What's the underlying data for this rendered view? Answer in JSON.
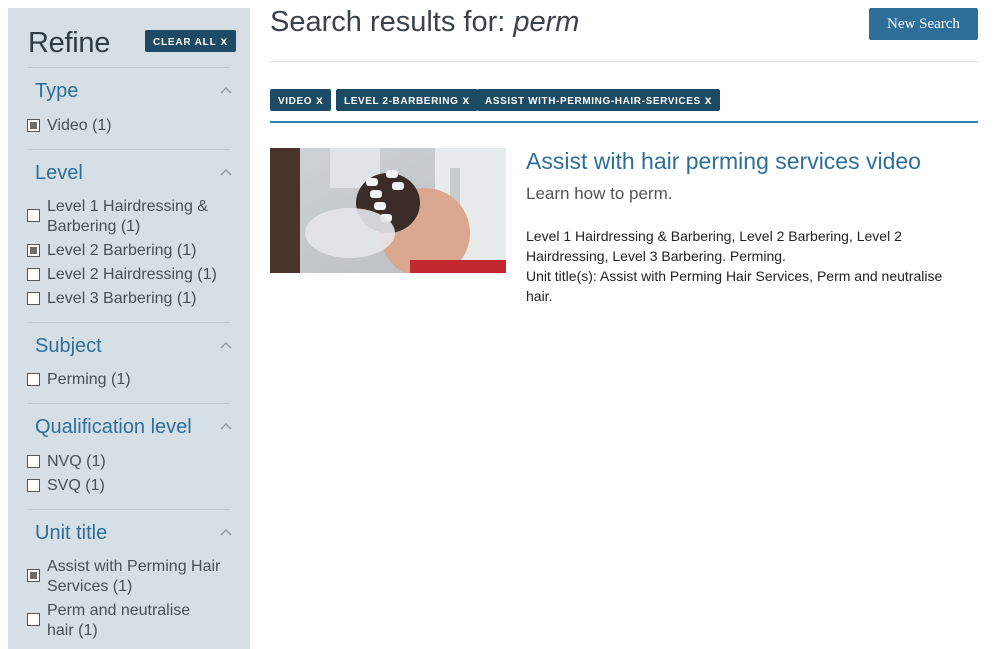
{
  "sidebar": {
    "heading": "Refine",
    "clear_all": "CLEAR ALL",
    "clear_all_x": "x",
    "sections": [
      {
        "title": "Type",
        "options": [
          {
            "label": "Video (1)",
            "checked": true
          }
        ]
      },
      {
        "title": "Level",
        "options": [
          {
            "label": "Level 1 Hairdressing & Barbering (1)",
            "line1": "Level 1 Hairdressing &",
            "line2": "Barbering (1)",
            "checked": false
          },
          {
            "label": "Level 2 Barbering (1)",
            "checked": true
          },
          {
            "label": "Level 2 Hairdressing (1)",
            "checked": false
          },
          {
            "label": "Level 3 Barbering (1)",
            "checked": false
          }
        ]
      },
      {
        "title": "Subject",
        "options": [
          {
            "label": "Perming (1)",
            "checked": false
          }
        ]
      },
      {
        "title": "Qualification level",
        "options": [
          {
            "label": "NVQ (1)",
            "checked": false
          },
          {
            "label": "SVQ (1)",
            "checked": false
          }
        ]
      },
      {
        "title": "Unit title",
        "options": [
          {
            "label": "Assist with Perming Hair Services (1)",
            "line1": "Assist with Perming Hair",
            "line2": "Services (1)",
            "checked": true
          },
          {
            "label": "Perm and neutralise hair (1)",
            "line1": "Perm and neutralise",
            "line2": "hair (1)",
            "checked": false
          }
        ]
      }
    ]
  },
  "main": {
    "search_prefix": "Search results for:",
    "query": "perm",
    "new_search": "New Search",
    "chips": [
      {
        "label": "VIDEO",
        "x": "x"
      },
      {
        "label": "LEVEL 2-BARBERING",
        "x": "x"
      },
      {
        "label": "ASSIST WITH-PERMING-HAIR-SERVICES",
        "x": "x"
      }
    ],
    "result": {
      "title": "Assist with hair perming services video",
      "description": "Learn how to perm.",
      "levels_line1": "Level 1 Hairdressing & Barbering, Level 2 Barbering, Level 2",
      "levels_line2": "Hairdressing, Level 3 Barbering. Perming.",
      "unit_line1": "Unit title(s): Assist with Perming Hair Services, Perm and neutralise",
      "unit_line2": "hair."
    }
  },
  "colors": {
    "sidebar_bg": "#d5dfe5",
    "accent_dark": "#1d4b66",
    "accent": "#2e6f9a",
    "rule": "#2e84b0"
  }
}
